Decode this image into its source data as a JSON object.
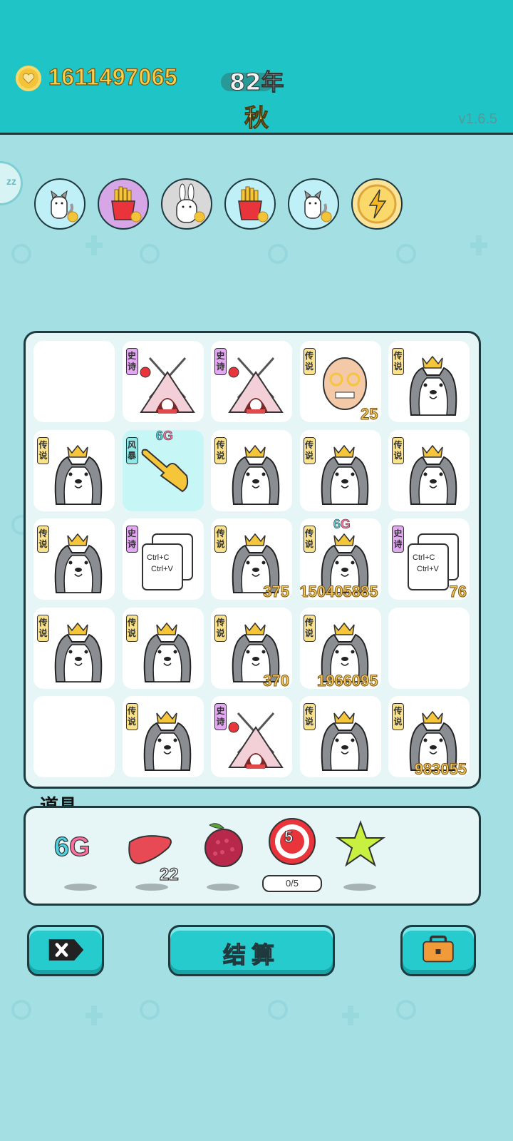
{
  "header": {
    "money": "1611497065",
    "year": "82年",
    "season": "秋",
    "version": "v1.6.5"
  },
  "characters": [
    {
      "icon": "husky-icon",
      "bg": "#bff0f7"
    },
    {
      "icon": "fries-icon",
      "bg": "#d7a6e6"
    },
    {
      "icon": "rabbit-icon",
      "bg": "#d8d8d8"
    },
    {
      "icon": "fries-icon",
      "bg": "#bff0f7"
    },
    {
      "icon": "husky-icon",
      "bg": "#bff0f7"
    },
    {
      "icon": "lightning-icon",
      "bg": "#fbe49a"
    }
  ],
  "board": {
    "rows": [
      [
        {
          "tag": "",
          "art": "empty",
          "num": ""
        },
        {
          "tag": "史诗",
          "art": "tent-icon",
          "num": ""
        },
        {
          "tag": "史诗",
          "art": "tent-icon",
          "num": ""
        },
        {
          "tag": "传说",
          "art": "old-man-icon",
          "num": "25"
        },
        {
          "tag": "传说",
          "art": "husky-king-icon",
          "num": ""
        }
      ],
      [
        {
          "tag": "传说",
          "art": "husky-king-icon",
          "num": ""
        },
        {
          "tag": "风暴",
          "art": "pointer-hand-icon",
          "num": "",
          "badge": "6G"
        },
        {
          "tag": "传说",
          "art": "husky-king-icon",
          "num": ""
        },
        {
          "tag": "传说",
          "art": "husky-king-icon",
          "num": ""
        },
        {
          "tag": "传说",
          "art": "husky-king-icon",
          "num": ""
        }
      ],
      [
        {
          "tag": "传说",
          "art": "husky-king-icon",
          "num": ""
        },
        {
          "tag": "史诗",
          "art": "ctrl-cv-icon",
          "num": ""
        },
        {
          "tag": "传说",
          "art": "husky-king-icon",
          "num": "375"
        },
        {
          "tag": "传说",
          "art": "husky-king-icon",
          "num": "150405885",
          "badge": "6G"
        },
        {
          "tag": "史诗",
          "art": "ctrl-cv-icon",
          "num": "76"
        }
      ],
      [
        {
          "tag": "传说",
          "art": "husky-king-icon",
          "num": ""
        },
        {
          "tag": "传说",
          "art": "husky-king-icon",
          "num": ""
        },
        {
          "tag": "传说",
          "art": "husky-king-icon",
          "num": "370"
        },
        {
          "tag": "传说",
          "art": "husky-king-icon",
          "num": "1966095"
        },
        {
          "tag": "",
          "art": "empty",
          "num": ""
        }
      ],
      [
        {
          "tag": "",
          "art": "empty",
          "num": ""
        },
        {
          "tag": "传说",
          "art": "husky-king-icon",
          "num": ""
        },
        {
          "tag": "史诗",
          "art": "tent-icon",
          "num": ""
        },
        {
          "tag": "传说",
          "art": "husky-king-icon",
          "num": ""
        },
        {
          "tag": "传说",
          "art": "husky-king-icon",
          "num": "983055"
        }
      ]
    ],
    "copy_text": [
      "Ctrl+C",
      "Ctrl+V"
    ]
  },
  "items": {
    "title": "道具",
    "list": [
      {
        "icon": "6g-icon",
        "label": "6G",
        "count": ""
      },
      {
        "icon": "liver-icon",
        "count": "22"
      },
      {
        "icon": "lychee-icon",
        "count": ""
      },
      {
        "icon": "target-icon",
        "value": "5",
        "progress": "0/5"
      },
      {
        "icon": "star-icon",
        "count": ""
      }
    ]
  },
  "buttons": {
    "settle": "结算"
  }
}
